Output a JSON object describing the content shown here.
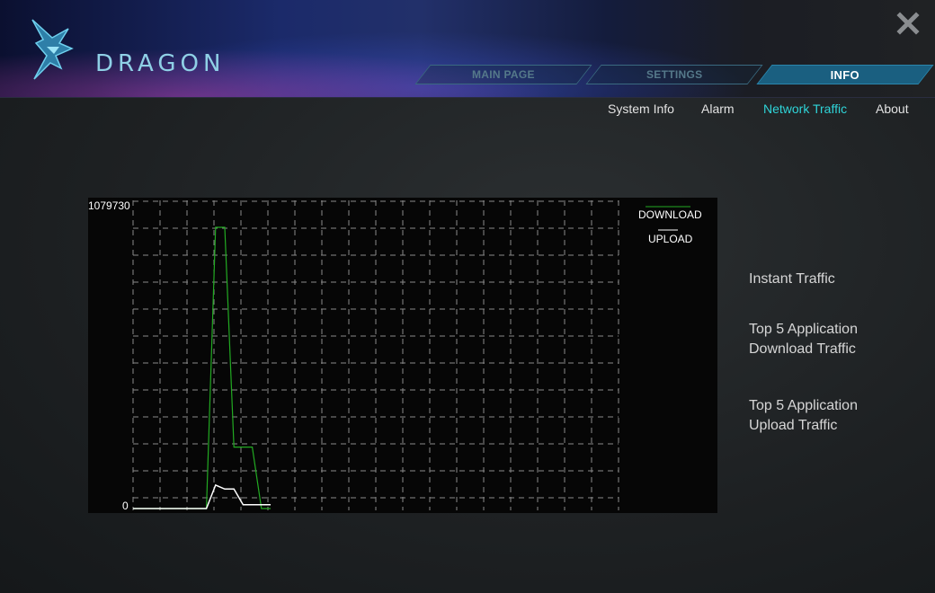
{
  "header": {
    "logo_text": "DRAGON",
    "tabs": [
      {
        "label": "MAIN PAGE",
        "active": false
      },
      {
        "label": "SETTINGS",
        "active": false
      },
      {
        "label": "INFO",
        "active": true
      }
    ],
    "close_icon": "close-icon"
  },
  "subnav": {
    "items": [
      {
        "label": "System Info",
        "active": false
      },
      {
        "label": "Alarm",
        "active": false
      },
      {
        "label": "Network Traffic",
        "active": true
      },
      {
        "label": "About",
        "active": false
      }
    ]
  },
  "side_links": {
    "instant": "Instant Traffic",
    "top_download_line1": "Top 5 Application",
    "top_download_line2": "Download Traffic",
    "top_upload_line1": "Top 5 Application",
    "top_upload_line2": "Upload Traffic"
  },
  "colors": {
    "accent": "#2fd4d8",
    "download": "#22aa22",
    "upload": "#ffffff",
    "tab_active": "#1a5f80"
  },
  "chart_data": {
    "type": "line",
    "ylim": [
      0,
      1079730
    ],
    "ytick_labels": [
      "1079730",
      "0"
    ],
    "grid": true,
    "legend_position": "top-right",
    "series": [
      {
        "name": "DOWNLOAD",
        "x": [
          0,
          1,
          2,
          3,
          4,
          5,
          6,
          7,
          8,
          9,
          10,
          11,
          12,
          13,
          14,
          15
        ],
        "values": [
          0,
          0,
          0,
          0,
          0,
          0,
          0,
          0,
          0,
          1079730,
          1079730,
          236000,
          236000,
          236000,
          0,
          0
        ]
      },
      {
        "name": "UPLOAD",
        "x": [
          0,
          1,
          2,
          3,
          4,
          5,
          6,
          7,
          8,
          9,
          10,
          11,
          12,
          13,
          14,
          15
        ],
        "values": [
          0,
          0,
          0,
          0,
          0,
          0,
          0,
          0,
          0,
          90000,
          75000,
          75000,
          15000,
          15000,
          15000,
          15000
        ]
      }
    ],
    "x_max": 54
  }
}
